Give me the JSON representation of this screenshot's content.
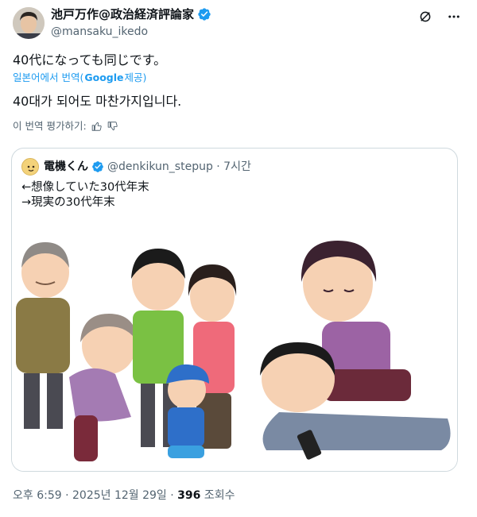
{
  "tweet": {
    "author": {
      "display_name": "池戸万作@政治経済評論家",
      "handle": "@mansaku_ikedo"
    },
    "text": "40代になっても同じです。",
    "translated_from_prefix": "일본어에서 번역(",
    "translated_from_google": "Google",
    "translated_from_suffix": " 제공)",
    "translation": "40대가 되어도 마찬가지입니다.",
    "rate_translation": "이 번역 평가하기:",
    "timestamp": "오후 6:59 · 2025년 12월 29일 · ",
    "views": "396",
    "views_label": " 조회수"
  },
  "quote": {
    "display_name": "電機くん",
    "handle_time": "@denkikun_stepup · 7시간",
    "text": "←想像していた30代年末\n→現実の30代年末"
  },
  "colors": {
    "accent": "#1d9bf0",
    "text": "#0f1419",
    "muted": "#536471",
    "border": "#cfd9de"
  },
  "icons": [
    "verified-badge-icon",
    "grok-icon",
    "more-icon",
    "thumbs-up-icon",
    "thumbs-down-icon"
  ]
}
